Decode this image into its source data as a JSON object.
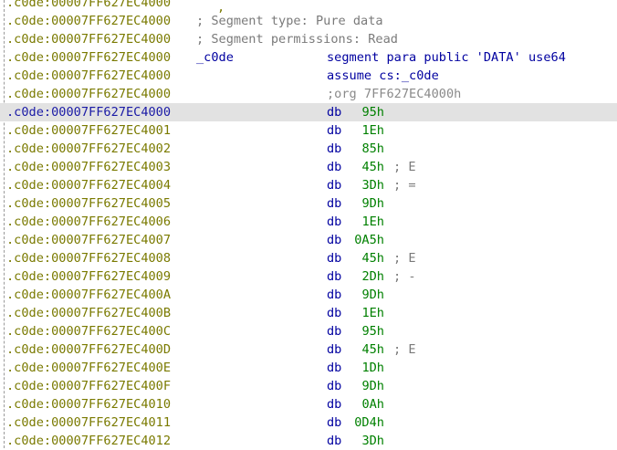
{
  "top_fragment": ",",
  "lines": [
    {
      "addr": ".c0de:00007FF627EC4000"
    },
    {
      "addr": ".c0de:00007FF627EC4000",
      "comment": "; Segment type: Pure data"
    },
    {
      "addr": ".c0de:00007FF627EC4000",
      "comment": "; Segment permissions: Read"
    },
    {
      "addr": ".c0de:00007FF627EC4000",
      "label": "_c0de",
      "directive": "segment para public 'DATA' use64"
    },
    {
      "addr": ".c0de:00007FF627EC4000",
      "directive": "assume cs:_c0de"
    },
    {
      "addr": ".c0de:00007FF627EC4000",
      "org": ";org 7FF627EC4000h"
    },
    {
      "addr": ".c0de:00007FF627EC4000",
      "mnemonic": "db",
      "value": "95h",
      "selected": true
    },
    {
      "addr": ".c0de:00007FF627EC4001",
      "mnemonic": "db",
      "value": "1Eh"
    },
    {
      "addr": ".c0de:00007FF627EC4002",
      "mnemonic": "db",
      "value": "85h"
    },
    {
      "addr": ".c0de:00007FF627EC4003",
      "mnemonic": "db",
      "value": "45h",
      "tail": "; E"
    },
    {
      "addr": ".c0de:00007FF627EC4004",
      "mnemonic": "db",
      "value": "3Dh",
      "tail": "; ="
    },
    {
      "addr": ".c0de:00007FF627EC4005",
      "mnemonic": "db",
      "value": "9Dh"
    },
    {
      "addr": ".c0de:00007FF627EC4006",
      "mnemonic": "db",
      "value": "1Eh"
    },
    {
      "addr": ".c0de:00007FF627EC4007",
      "mnemonic": "db",
      "value": "0A5h"
    },
    {
      "addr": ".c0de:00007FF627EC4008",
      "mnemonic": "db",
      "value": "45h",
      "tail": "; E"
    },
    {
      "addr": ".c0de:00007FF627EC4009",
      "mnemonic": "db",
      "value": "2Dh",
      "tail": "; -"
    },
    {
      "addr": ".c0de:00007FF627EC400A",
      "mnemonic": "db",
      "value": "9Dh"
    },
    {
      "addr": ".c0de:00007FF627EC400B",
      "mnemonic": "db",
      "value": "1Eh"
    },
    {
      "addr": ".c0de:00007FF627EC400C",
      "mnemonic": "db",
      "value": "95h"
    },
    {
      "addr": ".c0de:00007FF627EC400D",
      "mnemonic": "db",
      "value": "45h",
      "tail": "; E"
    },
    {
      "addr": ".c0de:00007FF627EC400E",
      "mnemonic": "db",
      "value": "1Dh"
    },
    {
      "addr": ".c0de:00007FF627EC400F",
      "mnemonic": "db",
      "value": "9Dh"
    },
    {
      "addr": ".c0de:00007FF627EC4010",
      "mnemonic": "db",
      "value": "0Ah"
    },
    {
      "addr": ".c0de:00007FF627EC4011",
      "mnemonic": "db",
      "value": "0D4h"
    },
    {
      "addr": ".c0de:00007FF627EC4012",
      "mnemonic": "db",
      "value": "3Dh"
    }
  ]
}
